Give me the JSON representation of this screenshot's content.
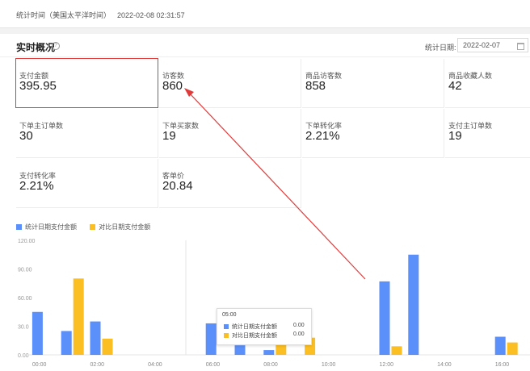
{
  "header": {
    "stat_label": "统计时间（美国太平洋时间）",
    "stat_time": "2022-02-08 02:31:57"
  },
  "panel": {
    "title": "实时概况",
    "date_label": "统计日期:",
    "date_value": "2022-02-07"
  },
  "metrics": [
    {
      "label": "支付金额",
      "value": "395.95"
    },
    {
      "label": "访客数",
      "value": "860"
    },
    {
      "label": "商品访客数",
      "value": "858"
    },
    {
      "label": "商品收藏人数",
      "value": "42"
    },
    {
      "label": "下单主订单数",
      "value": "30"
    },
    {
      "label": "下单买家数",
      "value": "19"
    },
    {
      "label": "下单转化率",
      "value": "2.21%"
    },
    {
      "label": "支付主订单数",
      "value": "19"
    },
    {
      "label": "支付转化率",
      "value": "2.21%"
    },
    {
      "label": "客单价",
      "value": "20.84"
    }
  ],
  "colors": {
    "current": "#5b8ff9",
    "compare": "#fbbf24",
    "highlight": "#e03b3b"
  },
  "chart_data": {
    "type": "bar",
    "title": "",
    "legend": [
      "统计日期支付金额",
      "对比日期支付金额"
    ],
    "legend_position": "top-left",
    "ylim": [
      0,
      120
    ],
    "y_ticks": [
      "120.00",
      "90.00",
      "60.00",
      "30.0",
      "0.00"
    ],
    "x_ticks": [
      "00:00",
      "02:00",
      "04:00",
      "06:00",
      "08:00",
      "10:00",
      "12:00",
      "14:00",
      "16:00"
    ],
    "categories": [
      "00:00",
      "01:00",
      "02:00",
      "03:00",
      "04:00",
      "05:00",
      "06:00",
      "07:00",
      "08:00",
      "09:00",
      "10:00",
      "11:00",
      "12:00",
      "13:00",
      "14:00",
      "15:00",
      "16:00"
    ],
    "series": [
      {
        "name": "统计日期支付金额",
        "values": [
          45,
          25,
          35,
          0,
          0,
          0,
          33,
          10,
          5,
          0,
          0,
          0,
          77,
          105,
          0,
          0,
          19
        ]
      },
      {
        "name": "对比日期支付金额",
        "values": [
          0,
          80,
          17,
          0,
          0,
          0,
          0,
          0,
          38,
          18,
          0,
          0,
          9,
          0,
          0,
          0,
          13
        ]
      }
    ],
    "grid": false
  },
  "tooltip": {
    "time": "05:00",
    "rows": [
      {
        "name": "统计日期支付金额",
        "value": "0.00"
      },
      {
        "name": "对比日期支付金额",
        "value": "0.00"
      }
    ]
  }
}
